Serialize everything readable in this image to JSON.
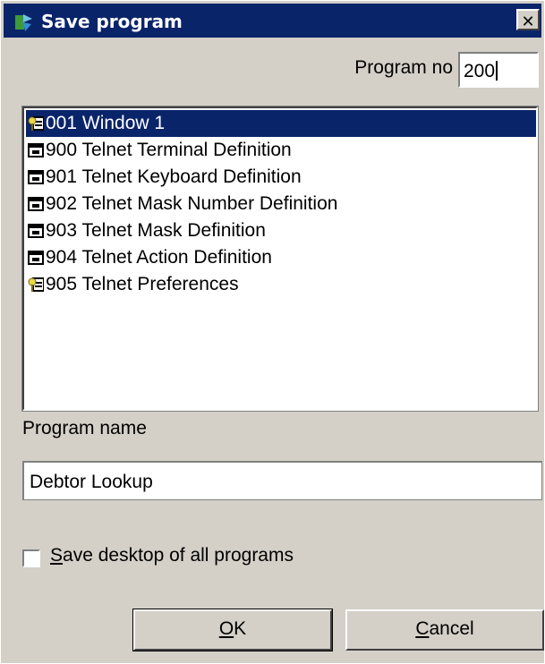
{
  "window": {
    "title": "Save program",
    "close_label": "✕"
  },
  "program_no": {
    "label": "Program no",
    "value": "200"
  },
  "programs": [
    {
      "label": "001 Window 1",
      "icon": "window-key-icon",
      "selected": true
    },
    {
      "label": "900 Telnet Terminal Definition",
      "icon": "window-icon",
      "selected": false
    },
    {
      "label": "901 Telnet Keyboard Definition",
      "icon": "window-icon",
      "selected": false
    },
    {
      "label": "902 Telnet Mask Number Definition",
      "icon": "window-icon",
      "selected": false
    },
    {
      "label": "903 Telnet Mask Definition",
      "icon": "window-icon",
      "selected": false
    },
    {
      "label": "904 Telnet Action Definition",
      "icon": "window-icon",
      "selected": false
    },
    {
      "label": "905 Telnet Preferences",
      "icon": "window-key-icon",
      "selected": false
    }
  ],
  "program_name": {
    "label": "Program name",
    "value": "Debtor Lookup"
  },
  "save_desktop": {
    "label_prefix": "S",
    "label_rest": "ave desktop of all programs",
    "checked": false
  },
  "buttons": {
    "ok": {
      "label_prefix": "O",
      "label_rest": "K"
    },
    "cancel": {
      "label_prefix": "C",
      "label_rest": "ancel"
    }
  },
  "colors": {
    "selection": "#0a246a",
    "dialog": "#d4d0c8"
  }
}
